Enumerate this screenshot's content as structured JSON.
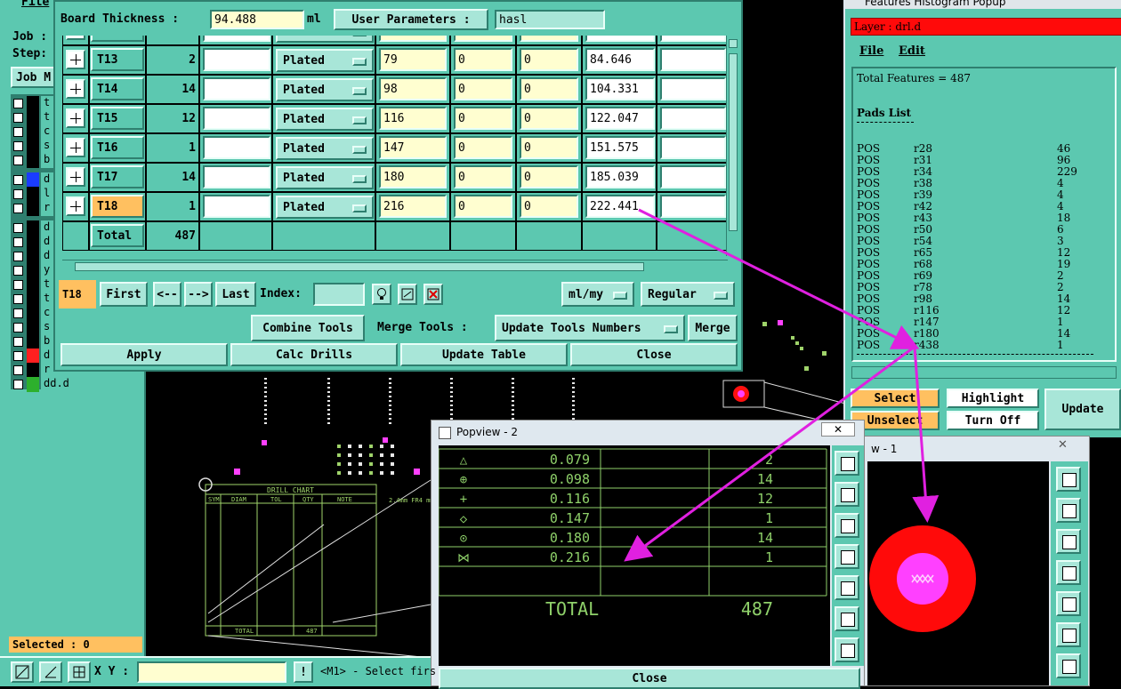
{
  "editor": {
    "board_thickness_label": "Board Thickness :",
    "board_thickness_value": "94.488",
    "board_thickness_unit": "ml",
    "user_params_label": "User Parameters :",
    "user_params_value": "hasl",
    "rows": [
      {
        "tool": "T13",
        "count": "2",
        "type": "Plated",
        "size": "79",
        "min": "0",
        "max": "0",
        "finish": "84.646",
        "selected": false
      },
      {
        "tool": "T14",
        "count": "14",
        "type": "Plated",
        "size": "98",
        "min": "0",
        "max": "0",
        "finish": "104.331",
        "selected": false
      },
      {
        "tool": "T15",
        "count": "12",
        "type": "Plated",
        "size": "116",
        "min": "0",
        "max": "0",
        "finish": "122.047",
        "selected": false
      },
      {
        "tool": "T16",
        "count": "1",
        "type": "Plated",
        "size": "147",
        "min": "0",
        "max": "0",
        "finish": "151.575",
        "selected": false
      },
      {
        "tool": "T17",
        "count": "14",
        "type": "Plated",
        "size": "180",
        "min": "0",
        "max": "0",
        "finish": "185.039",
        "selected": false
      },
      {
        "tool": "T18",
        "count": "1",
        "type": "Plated",
        "size": "216",
        "min": "0",
        "max": "0",
        "finish": "222.441",
        "selected": true
      }
    ],
    "partial_row_type": "Plated",
    "total_label": "Total",
    "total_value": "487",
    "current_tool": "T18",
    "first_label": "First",
    "prev_label": "<--",
    "next_label": "-->",
    "last_label": "Last",
    "index_label": "Index:",
    "units_option": "ml/my",
    "mode_option": "Regular",
    "combine_label": "Combine Tools",
    "merge_tools_label": "Merge Tools :",
    "update_numbers_option": "Update Tools Numbers",
    "merge_label": "Merge",
    "apply_label": "Apply",
    "calc_label": "Calc Drills",
    "update_table_label": "Update Table",
    "close_label": "Close"
  },
  "left_panel": {
    "file_menu": "File",
    "job_label": "Job :",
    "step_label": "Step:",
    "job_button": "Job M",
    "layers": [
      {
        "name": "t",
        "color": "#000000"
      },
      {
        "name": "t",
        "color": "#000000"
      },
      {
        "name": "c",
        "color": "#000000"
      },
      {
        "name": "s",
        "color": "#000000"
      },
      {
        "name": "b",
        "color": "#000000"
      },
      {
        "name": "d",
        "color": "#1a3cff"
      },
      {
        "name": "l",
        "color": "#000000"
      },
      {
        "name": "r",
        "color": "#000000"
      },
      {
        "name": "d",
        "color": "#000000"
      },
      {
        "name": "d",
        "color": "#000000"
      },
      {
        "name": "d",
        "color": "#000000"
      },
      {
        "name": "y",
        "color": "#000000"
      },
      {
        "name": "t",
        "color": "#000000"
      },
      {
        "name": "t",
        "color": "#000000"
      },
      {
        "name": "c",
        "color": "#000000"
      },
      {
        "name": "s",
        "color": "#000000"
      },
      {
        "name": "b",
        "color": "#000000"
      },
      {
        "name": "d",
        "color": "#ff2020"
      },
      {
        "name": "r",
        "color": "#000000"
      },
      {
        "name": "dd.d",
        "color": "#2db02d"
      }
    ],
    "selected_label": "Selected : 0"
  },
  "status_bar": {
    "xy_label": "X Y :",
    "message": "<M1> - Select firs"
  },
  "histogram": {
    "title": "Features Histogram Popup",
    "layer_label": "Layer :  drl.d",
    "menu_file": "File",
    "menu_edit": "Edit",
    "total_features": "Total Features = 487",
    "pads_header": "Pads List",
    "pads": [
      {
        "pol": "POS",
        "sym": "r28",
        "count": "46"
      },
      {
        "pol": "POS",
        "sym": "r31",
        "count": "96"
      },
      {
        "pol": "POS",
        "sym": "r34",
        "count": "229"
      },
      {
        "pol": "POS",
        "sym": "r38",
        "count": "4"
      },
      {
        "pol": "POS",
        "sym": "r39",
        "count": "4"
      },
      {
        "pol": "POS",
        "sym": "r42",
        "count": "4"
      },
      {
        "pol": "POS",
        "sym": "r43",
        "count": "18"
      },
      {
        "pol": "POS",
        "sym": "r50",
        "count": "6"
      },
      {
        "pol": "POS",
        "sym": "r54",
        "count": "3"
      },
      {
        "pol": "POS",
        "sym": "r65",
        "count": "12"
      },
      {
        "pol": "POS",
        "sym": "r68",
        "count": "19"
      },
      {
        "pol": "POS",
        "sym": "r69",
        "count": "2"
      },
      {
        "pol": "POS",
        "sym": "r78",
        "count": "2"
      },
      {
        "pol": "POS",
        "sym": "r98",
        "count": "14"
      },
      {
        "pol": "POS",
        "sym": "r116",
        "count": "12"
      },
      {
        "pol": "POS",
        "sym": "r147",
        "count": "1"
      },
      {
        "pol": "POS",
        "sym": "r180",
        "count": "14"
      },
      {
        "pol": "POS",
        "sym": "r438",
        "count": "1"
      }
    ],
    "select_label": "Select",
    "unselect_label": "Unselect",
    "highlight_label": "Highlight",
    "turn_off_label": "Turn Off",
    "update_label": "Update"
  },
  "popview2": {
    "title": "Popview - 2",
    "rows": [
      {
        "size": "0.079",
        "qty": "2"
      },
      {
        "size": "0.098",
        "qty": "14"
      },
      {
        "size": "0.116",
        "qty": "12"
      },
      {
        "size": "0.147",
        "qty": "1"
      },
      {
        "size": "0.180",
        "qty": "14"
      },
      {
        "size": "0.216",
        "qty": "1"
      }
    ],
    "total_label": "TOTAL",
    "total_value": "487",
    "close_label": "Close"
  },
  "popview1": {
    "title": "w - 1"
  },
  "drill_chart": {
    "title": "DRILL CHART",
    "headers": [
      "SYM",
      "DIAM",
      "TOL",
      "QTY",
      "NOTE"
    ],
    "side_note": "2.4mm FR4 mm",
    "total_label": "TOTAL",
    "total_value": "487"
  }
}
